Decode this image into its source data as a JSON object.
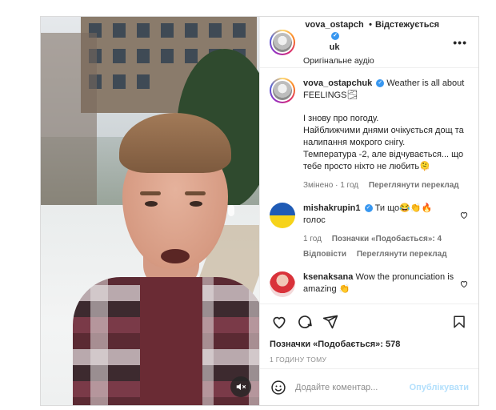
{
  "header": {
    "username_line1": "vova_ostapch",
    "username_line2": "uk",
    "separator": "•",
    "follow_label": "Відстежується",
    "audio_label": "Оригінальне аудіо",
    "more_label": "•••"
  },
  "caption": {
    "username": "vova_ostapchuk",
    "text_line1": "Weather is all about FEELINGS🌫",
    "text_body": [
      "І знову про погоду.",
      "Найближчими днями очікується дощ та налипання мокрого снігу.",
      "Температура -2, але відчувається... що тебе просто ніхто не любить🫠"
    ],
    "edited": "Змінено · 1 год",
    "translate": "Переглянути переклад"
  },
  "comments": [
    {
      "username": "mishakrupin1",
      "text": "Ти що😂👏🔥 голос",
      "time": "1 год",
      "likes": "Позначки «Подобається»: 4",
      "reply": "Відповісти",
      "translate": "Переглянути переклад"
    },
    {
      "username": "ksenaksana",
      "text": "Wow the pronunciation is amazing 👏"
    }
  ],
  "actions": {
    "likes_text": "Позначки «Подобається»: 578",
    "time_ago": "1 ГОДИНУ ТОМУ"
  },
  "composer": {
    "placeholder": "Додайте коментар...",
    "publish_label": "Опублікувати"
  },
  "icons": {
    "verified": "verified-badge-icon",
    "heart": "heart-icon",
    "comment": "comment-icon",
    "share": "share-icon",
    "save": "bookmark-icon",
    "emoji": "emoji-icon",
    "mute": "muted-speaker-icon"
  },
  "colors": {
    "verified_blue": "#3897f0",
    "publish_disabled": "#b2dffc",
    "muted_text": "#737373"
  }
}
